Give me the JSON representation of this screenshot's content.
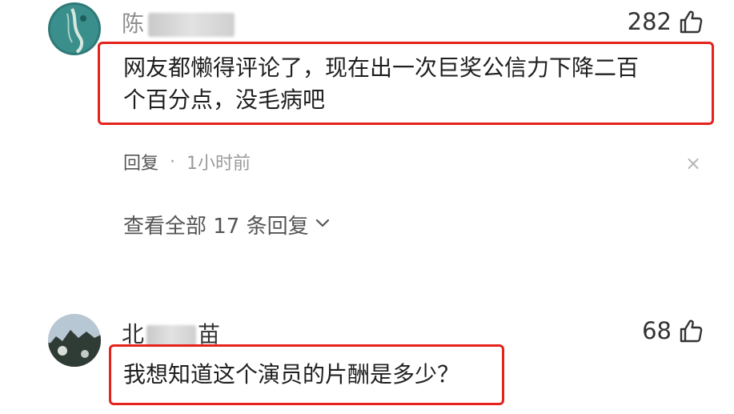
{
  "comments": [
    {
      "username": "陈",
      "likes": "282",
      "text": "网友都懒得评论了，现在出一次巨奖公信力下降二百\n个百分点，没毛病吧",
      "reply_label": "回复",
      "separator": "·",
      "time": "1小时前",
      "close_symbol": "×",
      "view_all": "查看全部 17 条回复"
    },
    {
      "username_start": "北",
      "username_end": "苗",
      "likes": "68",
      "text": "我想知道这个演员的片酬是多少？"
    }
  ],
  "colors": {
    "highlight": "#e5221c",
    "muted": "#9a9a9a"
  },
  "icons": {
    "like": "thumbs-up-icon",
    "close": "close-icon",
    "expand": "chevron-down-icon"
  }
}
